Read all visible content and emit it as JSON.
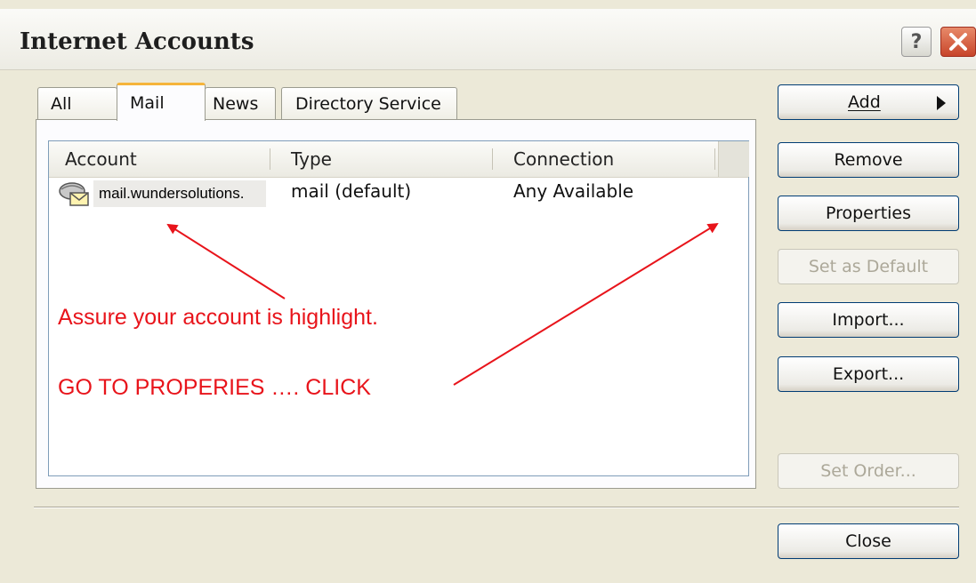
{
  "window": {
    "title": "Internet Accounts",
    "help_glyph": "?",
    "close_glyph": "✕"
  },
  "tabs": [
    {
      "label": "All",
      "active": false
    },
    {
      "label": "Mail",
      "active": true
    },
    {
      "label": "News",
      "active": false
    },
    {
      "label": "Directory Service",
      "active": false
    }
  ],
  "list": {
    "columns": [
      "Account",
      "Type",
      "Connection"
    ],
    "rows": [
      {
        "account": "mail.wundersolutions.",
        "type": "mail (default)",
        "connection": "Any Available",
        "icon": "mail-account-icon"
      }
    ]
  },
  "buttons": {
    "add": "Add",
    "remove": "Remove",
    "properties": "Properties",
    "set_default": "Set as Default",
    "import": "Import...",
    "export": "Export...",
    "set_order": "Set Order...",
    "close": "Close"
  },
  "annotations": {
    "line1": "Assure your account is highlight.",
    "line2": "GO TO PROPERIES …. CLICK",
    "color": "#e8141b"
  }
}
